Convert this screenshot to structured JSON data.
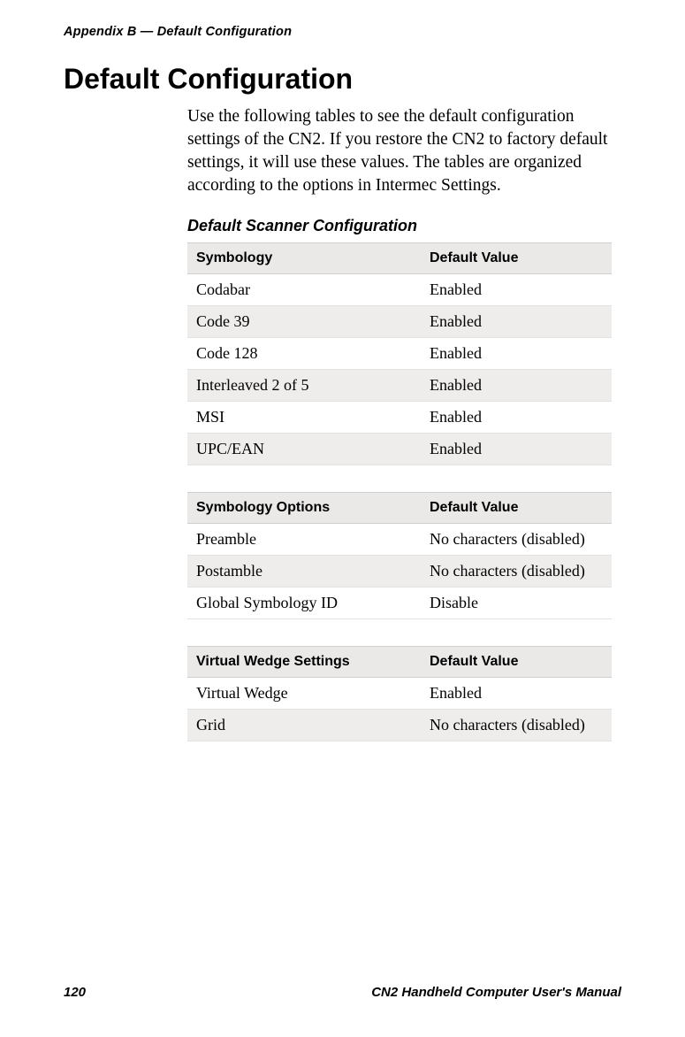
{
  "header": {
    "running_head": "Appendix B — Default Configuration"
  },
  "title": "Default Configuration",
  "intro": "Use the following tables to see the default configuration settings of the CN2. If you restore the CN2 to factory default settings, it will use these values. The tables are organized according to the options in Intermec Settings.",
  "section_title": "Default Scanner Configuration",
  "table1": {
    "headers": {
      "col1": "Symbology",
      "col2": "Default Value"
    },
    "rows": [
      {
        "col1": "Codabar",
        "col2": "Enabled"
      },
      {
        "col1": "Code 39",
        "col2": "Enabled"
      },
      {
        "col1": "Code 128",
        "col2": "Enabled"
      },
      {
        "col1": "Interleaved 2 of 5",
        "col2": "Enabled"
      },
      {
        "col1": "MSI",
        "col2": "Enabled"
      },
      {
        "col1": "UPC/EAN",
        "col2": "Enabled"
      }
    ]
  },
  "table2": {
    "headers": {
      "col1": "Symbology Options",
      "col2": "Default Value"
    },
    "rows": [
      {
        "col1": "Preamble",
        "col2": "No characters (disabled)"
      },
      {
        "col1": "Postamble",
        "col2": "No characters (disabled)"
      },
      {
        "col1": "Global Symbology ID",
        "col2": "Disable"
      }
    ]
  },
  "table3": {
    "headers": {
      "col1": "Virtual Wedge Settings",
      "col2": "Default Value"
    },
    "rows": [
      {
        "col1": "Virtual Wedge",
        "col2": "Enabled"
      },
      {
        "col1": "Grid",
        "col2": "No characters (disabled)"
      }
    ]
  },
  "footer": {
    "page_number": "120",
    "manual_title": "CN2 Handheld Computer User's Manual"
  }
}
